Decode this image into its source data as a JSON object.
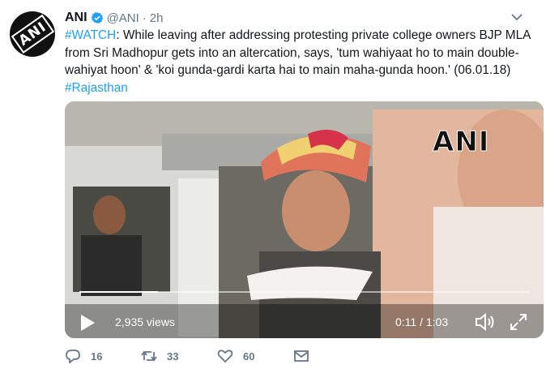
{
  "tweet": {
    "author_name": "ANI",
    "handle": "@ANI",
    "separator": "·",
    "time": "2h",
    "avatar_text": "ANI",
    "text_tag": "#WATCH",
    "text_body": ": While leaving after addressing protesting private college owners BJP MLA from Sri Madhopur gets into an altercation, says, 'tum wahiyaat ho to main double-wahiyat hoon' & 'koi gunda-gardi karta hai to main maha-gunda hoon.' (06.01.18) ",
    "text_hashtag": "#Rajasthan"
  },
  "video": {
    "watermark": "ANI",
    "views": "2,935 views",
    "time_display": "0:11 / 1:03",
    "progress_fraction": 0.175
  },
  "actions": {
    "replies": "16",
    "retweets": "33",
    "likes": "60"
  },
  "colors": {
    "link": "#1da1f2",
    "secondary_text": "#657786",
    "verified": "#1da1f2"
  },
  "icons": [
    "verified-badge-icon",
    "caret-down-icon",
    "play-icon",
    "volume-icon",
    "fullscreen-icon",
    "reply-icon",
    "retweet-icon",
    "like-icon",
    "message-icon"
  ]
}
